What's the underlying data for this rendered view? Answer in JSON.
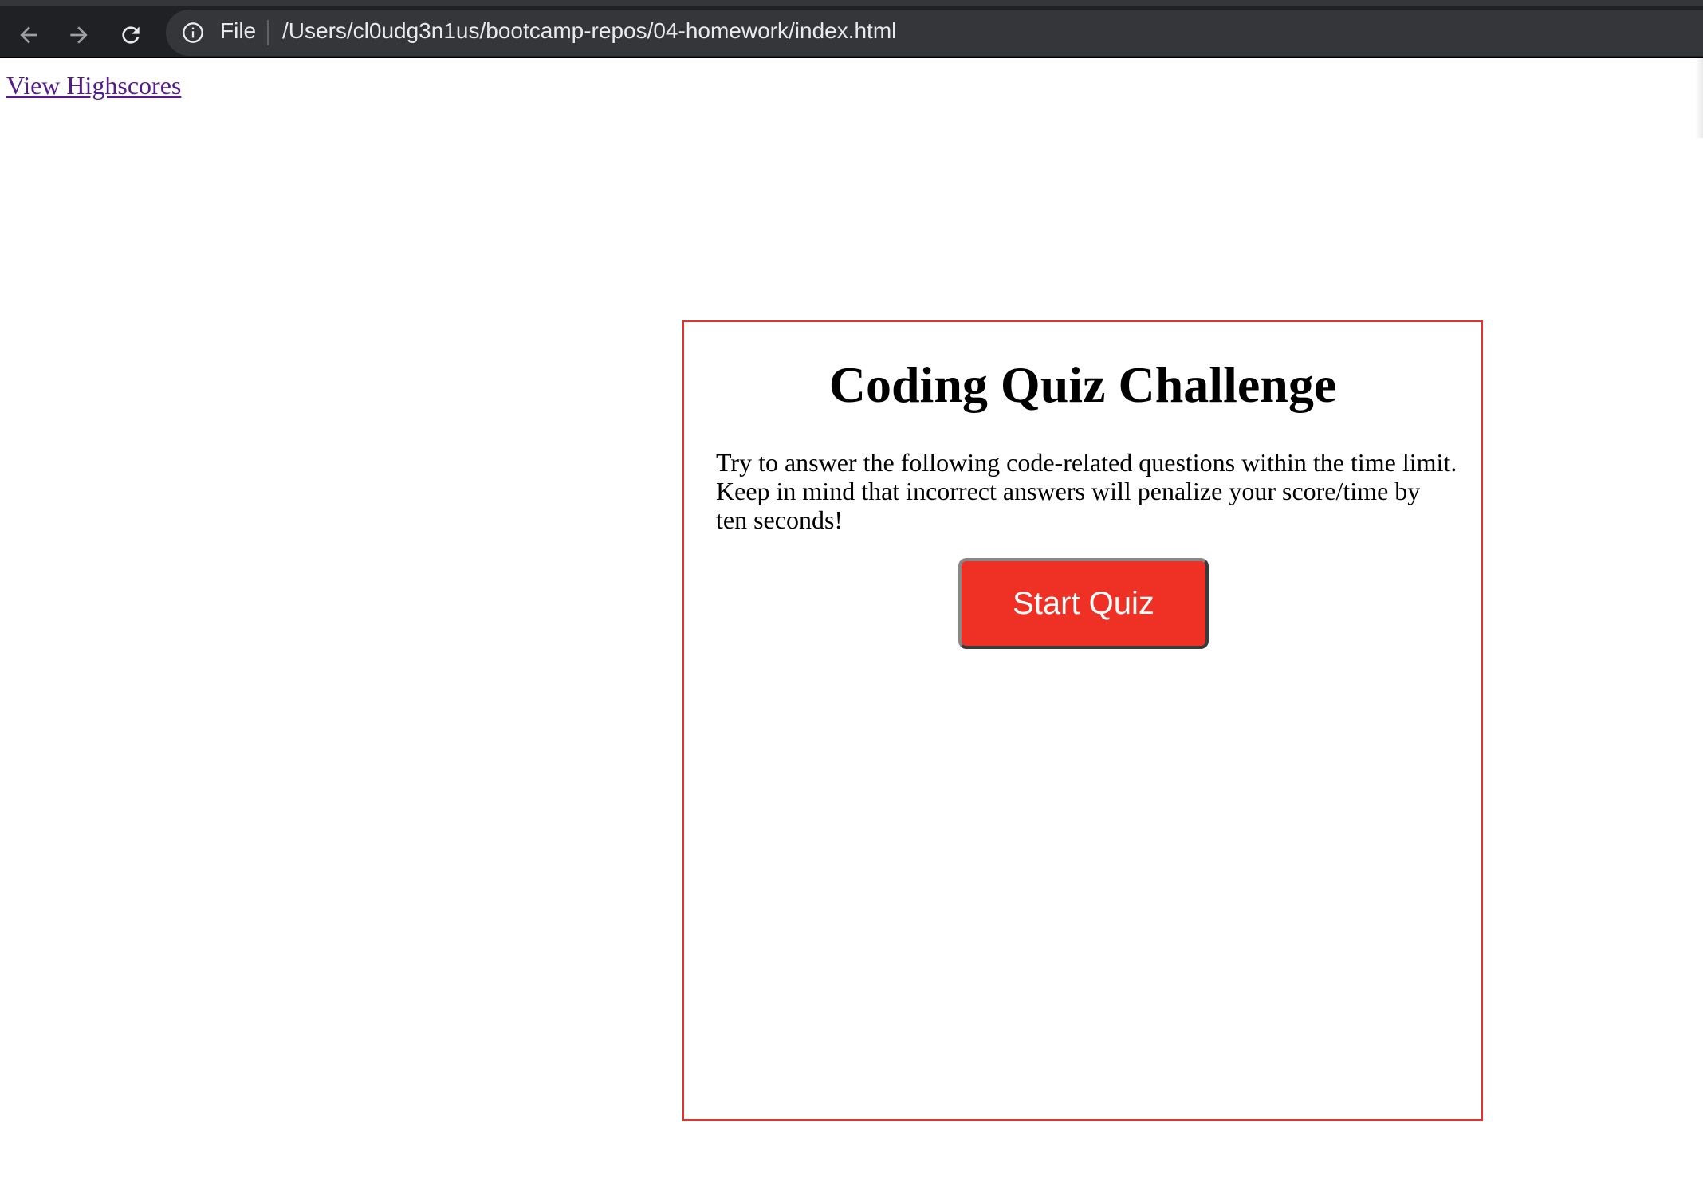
{
  "browser": {
    "scheme_label": "File",
    "url": "/Users/cl0udg3n1us/bootcamp-repos/04-homework/index.html",
    "icons": {
      "back": "arrow-left-icon",
      "forward": "arrow-right-icon",
      "reload": "reload-icon",
      "info": "info-icon"
    }
  },
  "header": {
    "highscores_link": "View Highscores"
  },
  "quiz": {
    "title": "Coding Quiz Challenge",
    "description": "Try to answer the following code-related questions within the time limit. Keep in mind that incorrect answers will penalize your score/time by ten seconds!",
    "start_button": "Start Quiz"
  },
  "colors": {
    "browser_bar": "#202124",
    "card_border": "#e8302a",
    "start_button": "#ee3124",
    "link_visited": "#551a8b"
  }
}
